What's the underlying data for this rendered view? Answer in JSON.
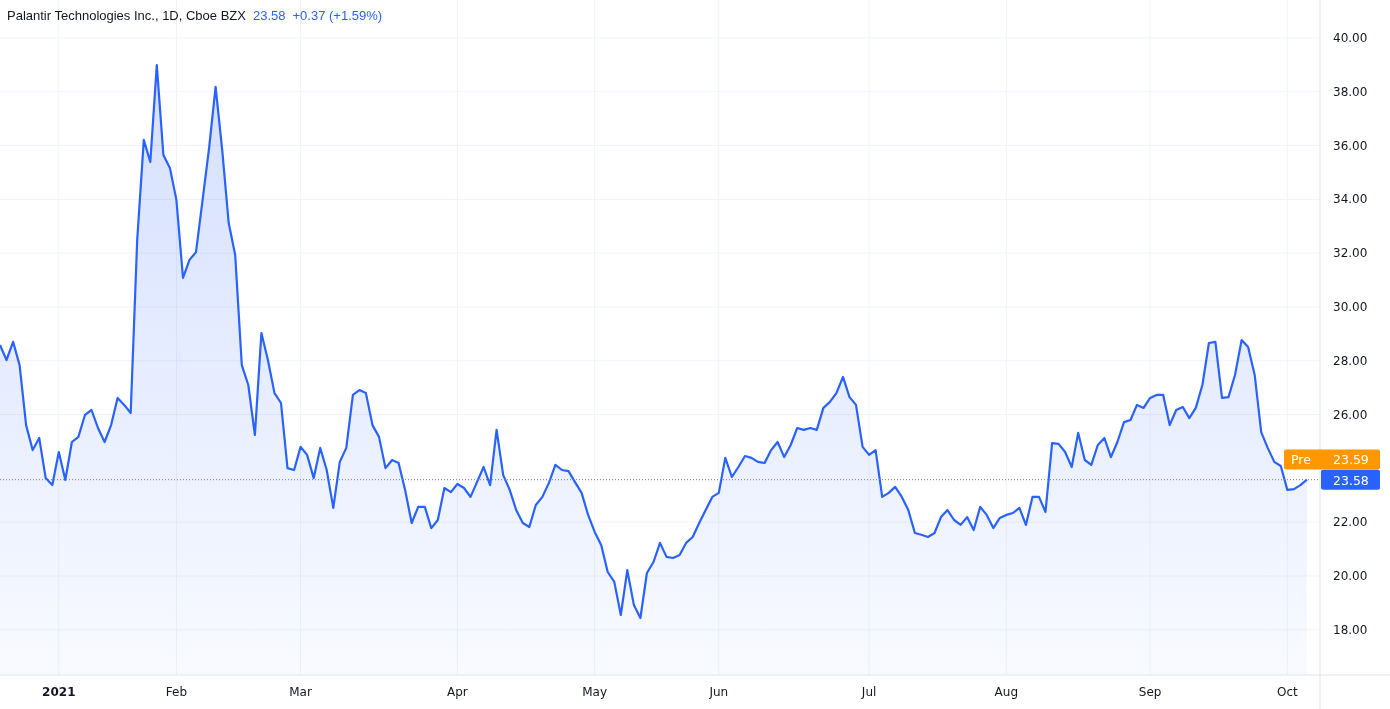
{
  "header": {
    "title": "Palantir Technologies Inc., 1D, Cboe BZX",
    "price": "23.58",
    "change": "+0.37 (+1.59%)"
  },
  "chart": {
    "chart_data": {
      "type": "area",
      "categories": [
        null,
        null,
        null,
        null,
        null,
        null,
        null,
        null,
        null,
        "2021",
        null,
        null,
        null,
        null,
        null,
        null,
        null,
        null,
        null,
        null,
        null,
        null,
        null,
        null,
        null,
        null,
        null,
        "Feb",
        null,
        null,
        null,
        null,
        null,
        null,
        null,
        null,
        null,
        null,
        null,
        null,
        null,
        null,
        null,
        null,
        null,
        null,
        "Mar",
        null,
        null,
        null,
        null,
        null,
        null,
        null,
        null,
        null,
        null,
        null,
        null,
        null,
        null,
        null,
        null,
        null,
        null,
        null,
        null,
        null,
        null,
        null,
        "Apr",
        null,
        null,
        null,
        null,
        null,
        null,
        null,
        null,
        null,
        null,
        null,
        null,
        null,
        null,
        null,
        null,
        null,
        null,
        null,
        null,
        "May",
        null,
        null,
        null,
        null,
        null,
        null,
        null,
        null,
        null,
        null,
        null,
        null,
        null,
        null,
        null,
        null,
        null,
        null,
        "Jun",
        null,
        null,
        null,
        null,
        null,
        null,
        null,
        null,
        null,
        null,
        null,
        null,
        null,
        null,
        null,
        null,
        null,
        null,
        null,
        null,
        null,
        null,
        "Jul",
        null,
        null,
        null,
        null,
        null,
        null,
        null,
        null,
        null,
        null,
        null,
        null,
        null,
        null,
        null,
        null,
        null,
        null,
        null,
        null,
        "Aug",
        null,
        null,
        null,
        null,
        null,
        null,
        null,
        null,
        null,
        null,
        null,
        null,
        null,
        null,
        null,
        null,
        null,
        null,
        null,
        null,
        null,
        "Sep",
        null,
        null,
        null,
        null,
        null,
        null,
        null,
        null,
        null,
        null,
        null,
        null,
        null,
        null,
        null,
        null,
        null,
        null,
        null,
        null,
        "Oct",
        null,
        null,
        null
      ],
      "series": [
        {
          "color": "#2962ff",
          "values": [
            28.59,
            28.03,
            28.7,
            27.84,
            25.61,
            24.68,
            25.13,
            23.64,
            23.38,
            24.61,
            23.57,
            24.98,
            25.17,
            25.99,
            26.17,
            25.5,
            24.98,
            25.61,
            26.62,
            26.36,
            26.06,
            32.49,
            36.21,
            35.39,
            38.99,
            35.65,
            35.17,
            33.98,
            31.08,
            31.75,
            32.04,
            33.98,
            35.91,
            38.18,
            35.84,
            33.12,
            31.93,
            27.84,
            27.1,
            25.24,
            29.03,
            28.03,
            26.8,
            26.43,
            24.01,
            23.94,
            24.8,
            24.5,
            23.64,
            24.76,
            23.94,
            22.53,
            24.24,
            24.76,
            26.73,
            26.91,
            26.8,
            25.61,
            25.17,
            24.01,
            24.31,
            24.2,
            23.2,
            21.97,
            22.57,
            22.57,
            21.78,
            22.08,
            23.27,
            23.12,
            23.42,
            23.27,
            22.94,
            23.49,
            24.05,
            23.38,
            25.43,
            23.75,
            23.2,
            22.45,
            21.97,
            21.82,
            22.64,
            22.94,
            23.46,
            24.13,
            23.94,
            23.9,
            23.49,
            23.09,
            22.27,
            21.64,
            21.15,
            20.15,
            19.78,
            18.55,
            20.22,
            18.92,
            18.44,
            20.11,
            20.52,
            21.23,
            20.71,
            20.67,
            20.78,
            21.23,
            21.45,
            21.97,
            22.45,
            22.94,
            23.09,
            24.39,
            23.68,
            24.05,
            24.46,
            24.39,
            24.24,
            24.2,
            24.68,
            24.98,
            24.42,
            24.87,
            25.5,
            25.43,
            25.5,
            25.43,
            26.25,
            26.47,
            26.8,
            27.4,
            26.65,
            26.36,
            24.8,
            24.5,
            24.68,
            22.94,
            23.09,
            23.31,
            22.94,
            22.45,
            21.6,
            21.53,
            21.45,
            21.6,
            22.19,
            22.45,
            22.08,
            21.9,
            22.19,
            21.71,
            22.57,
            22.27,
            21.78,
            22.16,
            22.27,
            22.34,
            22.53,
            21.9,
            22.94,
            22.94,
            22.38,
            24.94,
            24.91,
            24.61,
            24.05,
            25.32,
            24.31,
            24.13,
            24.87,
            25.13,
            24.42,
            24.98,
            25.72,
            25.8,
            26.36,
            26.25,
            26.62,
            26.73,
            26.73,
            25.61,
            26.17,
            26.28,
            25.87,
            26.25,
            27.1,
            28.66,
            28.7,
            26.62,
            26.65,
            27.47,
            28.77,
            28.51,
            27.47,
            25.35,
            24.76,
            24.24,
            24.09,
            23.2,
            23.23,
            23.38,
            23.58
          ]
        }
      ],
      "ylim": [
        16.32,
        41.41
      ],
      "grid": true,
      "ref_lines": [
        {
          "axis": "y",
          "value": 23.58
        }
      ],
      "yticks": [
        {
          "value": 18,
          "label": "18.00"
        },
        {
          "value": 20,
          "label": "20.00"
        },
        {
          "value": 22,
          "label": "22.00"
        },
        {
          "value": 26,
          "label": "26.00"
        },
        {
          "value": 28,
          "label": "28.00"
        },
        {
          "value": 30,
          "label": "30.00"
        },
        {
          "value": 32,
          "label": "32.00"
        },
        {
          "value": 34,
          "label": "34.00"
        },
        {
          "value": 36,
          "label": "36.00"
        },
        {
          "value": 38,
          "label": "38.00"
        },
        {
          "value": 40,
          "label": "40.00"
        }
      ]
    },
    "price_tags": [
      {
        "kind": "pre",
        "label": "Pre",
        "value": "23.59",
        "color": "#ff9800"
      },
      {
        "kind": "last",
        "value": "23.58",
        "color": "#2962ff"
      }
    ]
  }
}
